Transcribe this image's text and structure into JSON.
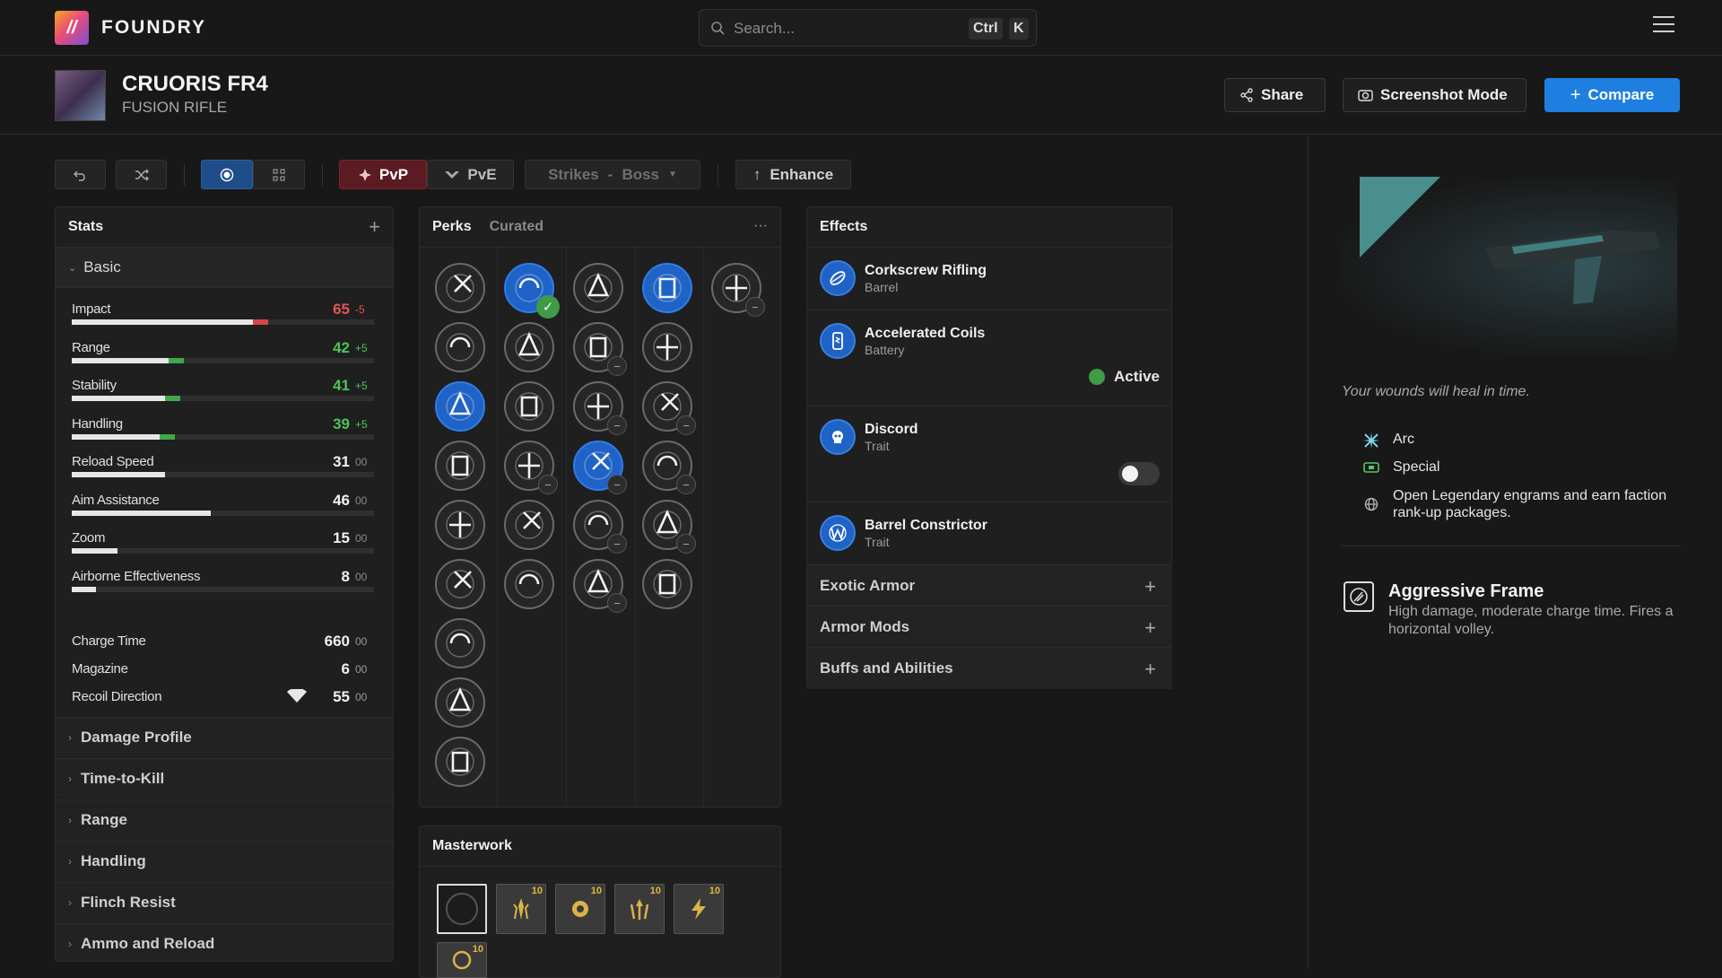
{
  "app": {
    "name": "FOUNDRY",
    "menu_icon": "hamburger-icon"
  },
  "search": {
    "placeholder": "Search...",
    "key1": "Ctrl",
    "key2": "K"
  },
  "weapon": {
    "name": "CRUORIS FR4",
    "type": "FUSION RIFLE"
  },
  "header_buttons": {
    "share": "Share",
    "screenshot": "Screenshot Mode",
    "compare": "Compare"
  },
  "toolbar": {
    "pvp": "PvP",
    "pve": "PvE",
    "activity": "Strikes",
    "activity_sep": "-",
    "target": "Boss",
    "enhance": "Enhance"
  },
  "stats": {
    "title": "Stats",
    "section": "Basic",
    "bars": [
      {
        "label": "Impact",
        "value": "65",
        "mod": "-5",
        "fill": 0.65,
        "delta": 0.05,
        "delta_color": "#d9434b",
        "val_color": "#e25555"
      },
      {
        "label": "Range",
        "value": "42",
        "mod": "+5",
        "fill": 0.37,
        "delta": 0.05,
        "delta_color": "#3ea84a",
        "val_color": "#4cc45a"
      },
      {
        "label": "Stability",
        "value": "41",
        "mod": "+5",
        "fill": 0.36,
        "delta": 0.05,
        "delta_color": "#3ea84a",
        "val_color": "#4cc45a"
      },
      {
        "label": "Handling",
        "value": "39",
        "mod": "+5",
        "fill": 0.34,
        "delta": 0.05,
        "delta_color": "#3ea84a",
        "val_color": "#4cc45a"
      },
      {
        "label": "Reload Speed",
        "value": "31",
        "mod": "00",
        "fill": 0.31,
        "delta": 0,
        "delta_color": "#3ea84a",
        "val_color": "#f0f0f0"
      },
      {
        "label": "Aim Assistance",
        "value": "46",
        "mod": "00",
        "fill": 0.46,
        "delta": 0,
        "delta_color": "#3ea84a",
        "val_color": "#f0f0f0"
      },
      {
        "label": "Zoom",
        "value": "15",
        "mod": "00",
        "fill": 0.15,
        "delta": 0,
        "delta_color": "#3ea84a",
        "val_color": "#f0f0f0"
      },
      {
        "label": "Airborne Effectiveness",
        "value": "8",
        "mod": "00",
        "fill": 0.08,
        "delta": 0,
        "delta_color": "#3ea84a",
        "val_color": "#f0f0f0"
      }
    ],
    "plain": [
      {
        "label": "Charge Time",
        "value": "660",
        "mod": "00"
      },
      {
        "label": "Magazine",
        "value": "6",
        "mod": "00"
      },
      {
        "label": "Recoil Direction",
        "value": "55",
        "mod": "00"
      }
    ],
    "sections": [
      "Damage Profile",
      "Time-to-Kill",
      "Range",
      "Handling",
      "Flinch Resist",
      "Ammo and Reload"
    ]
  },
  "perks": {
    "tab_active": "Perks",
    "tab_other": "Curated",
    "more": "···"
  },
  "masterwork": {
    "title": "Masterwork",
    "levels": [
      "10",
      "10",
      "10",
      "10",
      "10"
    ]
  },
  "effects": {
    "title": "Effects",
    "items": [
      {
        "name": "Corkscrew Rifling",
        "sub": "Barrel"
      },
      {
        "name": "Accelerated Coils",
        "sub": "Battery",
        "status": "Active"
      },
      {
        "name": "Discord",
        "sub": "Trait"
      },
      {
        "name": "Barrel Constrictor",
        "sub": "Trait"
      }
    ],
    "sections": [
      "Exotic Armor",
      "Armor Mods",
      "Buffs and Abilities"
    ]
  },
  "info": {
    "flavor": "Your wounds will heal in time.",
    "element": "Arc",
    "ammo": "Special",
    "source": "Open Legendary engrams and earn faction rank-up packages.",
    "frame_name": "Aggressive Frame",
    "frame_desc": "High damage, moderate charge time. Fires a horizontal volley."
  },
  "colors": {
    "accent": "#1e7fe0",
    "perk_selected": "#1f63c7",
    "positive": "#4cc45a",
    "negative": "#e25555",
    "pvp": "#6e1f24",
    "arc": "#7fd6f0"
  }
}
